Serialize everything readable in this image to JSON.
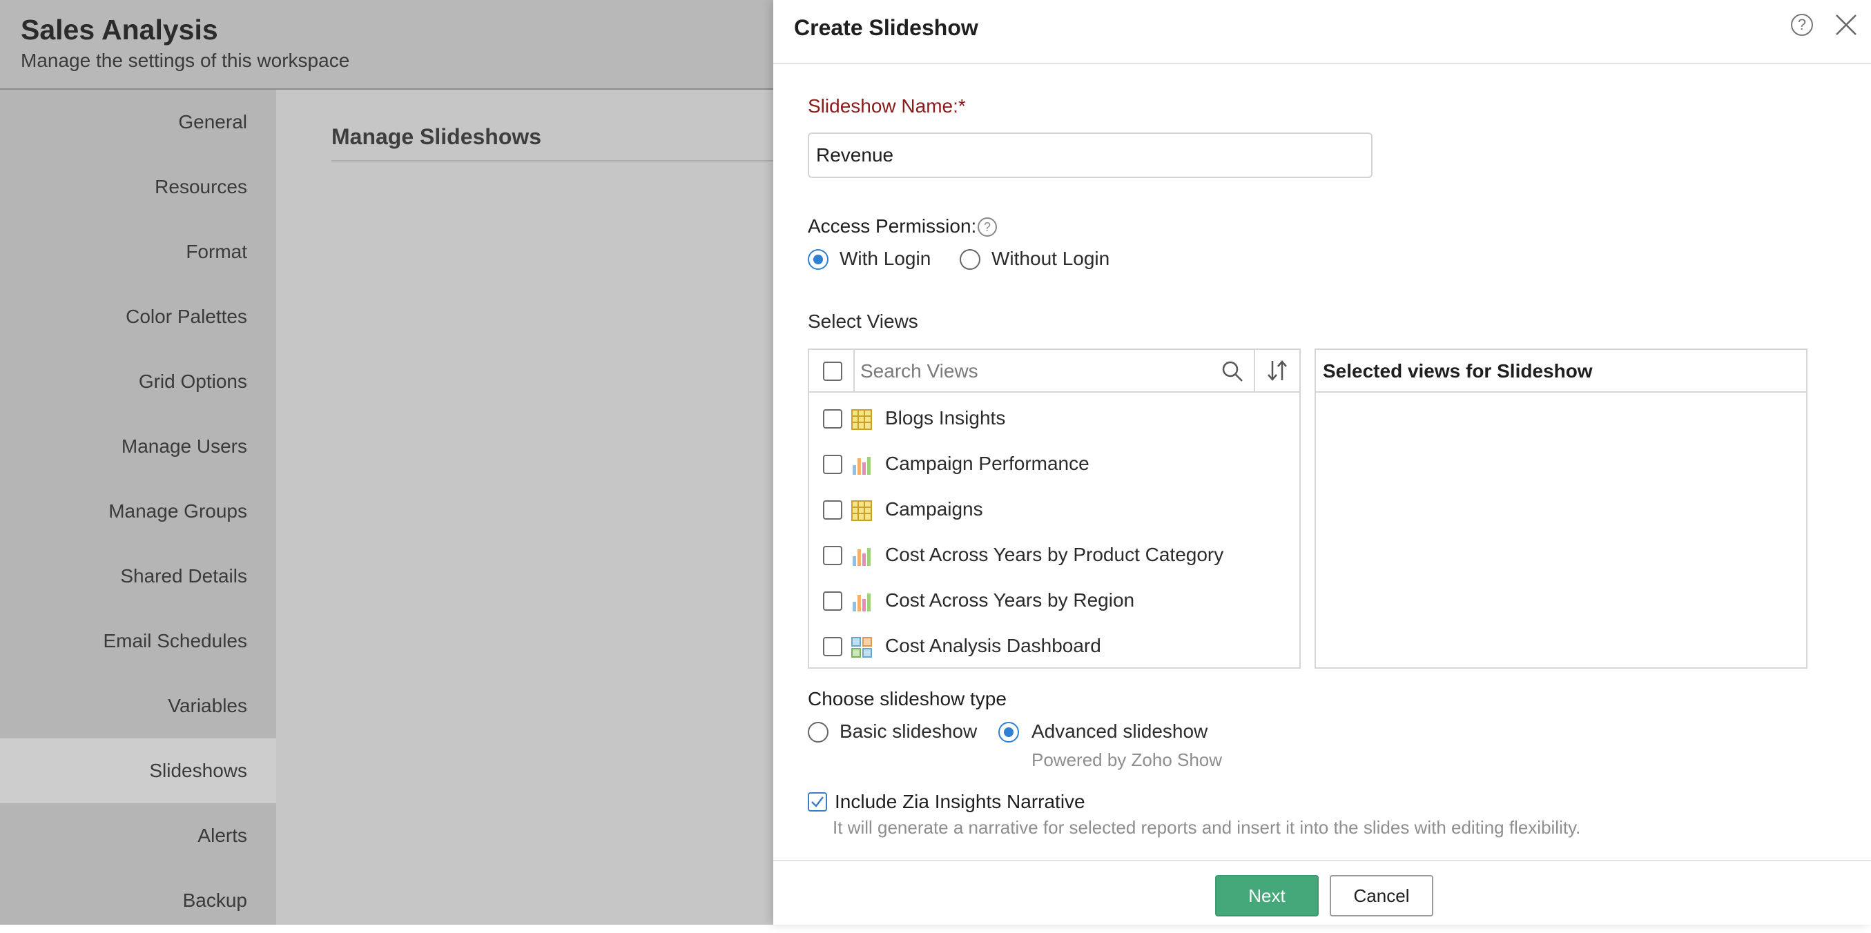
{
  "workspace": {
    "title": "Sales Analysis",
    "subtitle": "Manage the settings of this workspace",
    "section_title": "Manage Slideshows",
    "nav": [
      {
        "label": "General"
      },
      {
        "label": "Resources"
      },
      {
        "label": "Format"
      },
      {
        "label": "Color Palettes"
      },
      {
        "label": "Grid Options"
      },
      {
        "label": "Manage Users"
      },
      {
        "label": "Manage Groups"
      },
      {
        "label": "Shared Details"
      },
      {
        "label": "Email Schedules"
      },
      {
        "label": "Variables"
      },
      {
        "label": "Slideshows",
        "active": true
      },
      {
        "label": "Alerts"
      },
      {
        "label": "Backup"
      }
    ]
  },
  "dialog": {
    "title": "Create Slideshow",
    "name_label": "Slideshow Name:*",
    "name_value": "Revenue",
    "access_label": "Access Permission:",
    "access_options": [
      {
        "label": "With Login",
        "selected": true
      },
      {
        "label": "Without Login",
        "selected": false
      }
    ],
    "select_views_label": "Select Views",
    "search_placeholder": "Search Views",
    "views": [
      {
        "label": "Blogs Insights",
        "icon": "table-icon"
      },
      {
        "label": "Campaign Performance",
        "icon": "bar-chart-icon"
      },
      {
        "label": "Campaigns",
        "icon": "table-icon"
      },
      {
        "label": "Cost Across Years by Product Category",
        "icon": "bar-chart-icon"
      },
      {
        "label": "Cost Across Years by Region",
        "icon": "bar-chart-icon"
      },
      {
        "label": "Cost Analysis Dashboard",
        "icon": "dashboard-icon"
      }
    ],
    "selected_views_title": "Selected views for Slideshow",
    "type_label": "Choose slideshow type",
    "type_options": [
      {
        "label": "Basic slideshow",
        "selected": false
      },
      {
        "label": "Advanced slideshow",
        "selected": true
      }
    ],
    "powered_by": "Powered by Zoho Show",
    "zia_label": "Include Zia Insights Narrative",
    "zia_checked": true,
    "zia_description": "It will generate a narrative for selected reports and insert it into the slides with editing flexibility.",
    "next_label": "Next",
    "cancel_label": "Cancel"
  },
  "colors": {
    "accent": "#2f80d1",
    "primary_button": "#44a87a",
    "required_label": "#8b1a1a"
  }
}
